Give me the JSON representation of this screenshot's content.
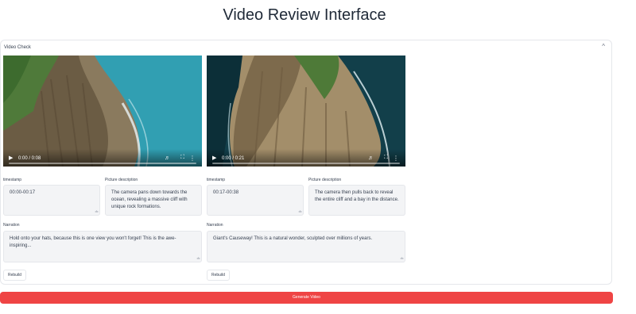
{
  "page": {
    "title": "Video Review Interface"
  },
  "panel": {
    "label": "Video Check",
    "toggle_icon": "chevron-up-icon"
  },
  "clips": [
    {
      "video": {
        "time": "0:00 / 0:08",
        "progress": 0
      },
      "timestamp_label": "timestamp",
      "timestamp_value": "00:00-00:17",
      "description_label": "Picture description",
      "description_value": "The camera pans down towards the ocean, revealing a massive cliff with unique rock formations.",
      "narration_label": "Narration",
      "narration_value": "Hold onto your hats, because this is one view you won't forget! This is the awe-inspiring...",
      "rebuild_label": "Rebuild"
    },
    {
      "video": {
        "time": "0:00 / 0:21",
        "progress": 0
      },
      "timestamp_label": "timestamp",
      "timestamp_value": "00:17-00:38",
      "description_label": "Picture description",
      "description_value": "The camera then pulls back to reveal the entire cliff and a bay in the distance.",
      "narration_label": "Narration",
      "narration_value": "Giant's Causeway! This is a natural wonder, sculpted over millions of years.",
      "rebuild_label": "Rebuild"
    }
  ],
  "generate_label": "Generate Video",
  "colors": {
    "accent": "#ef4444",
    "field_bg": "#f3f4f6",
    "ocean": "#2a8fa3"
  }
}
